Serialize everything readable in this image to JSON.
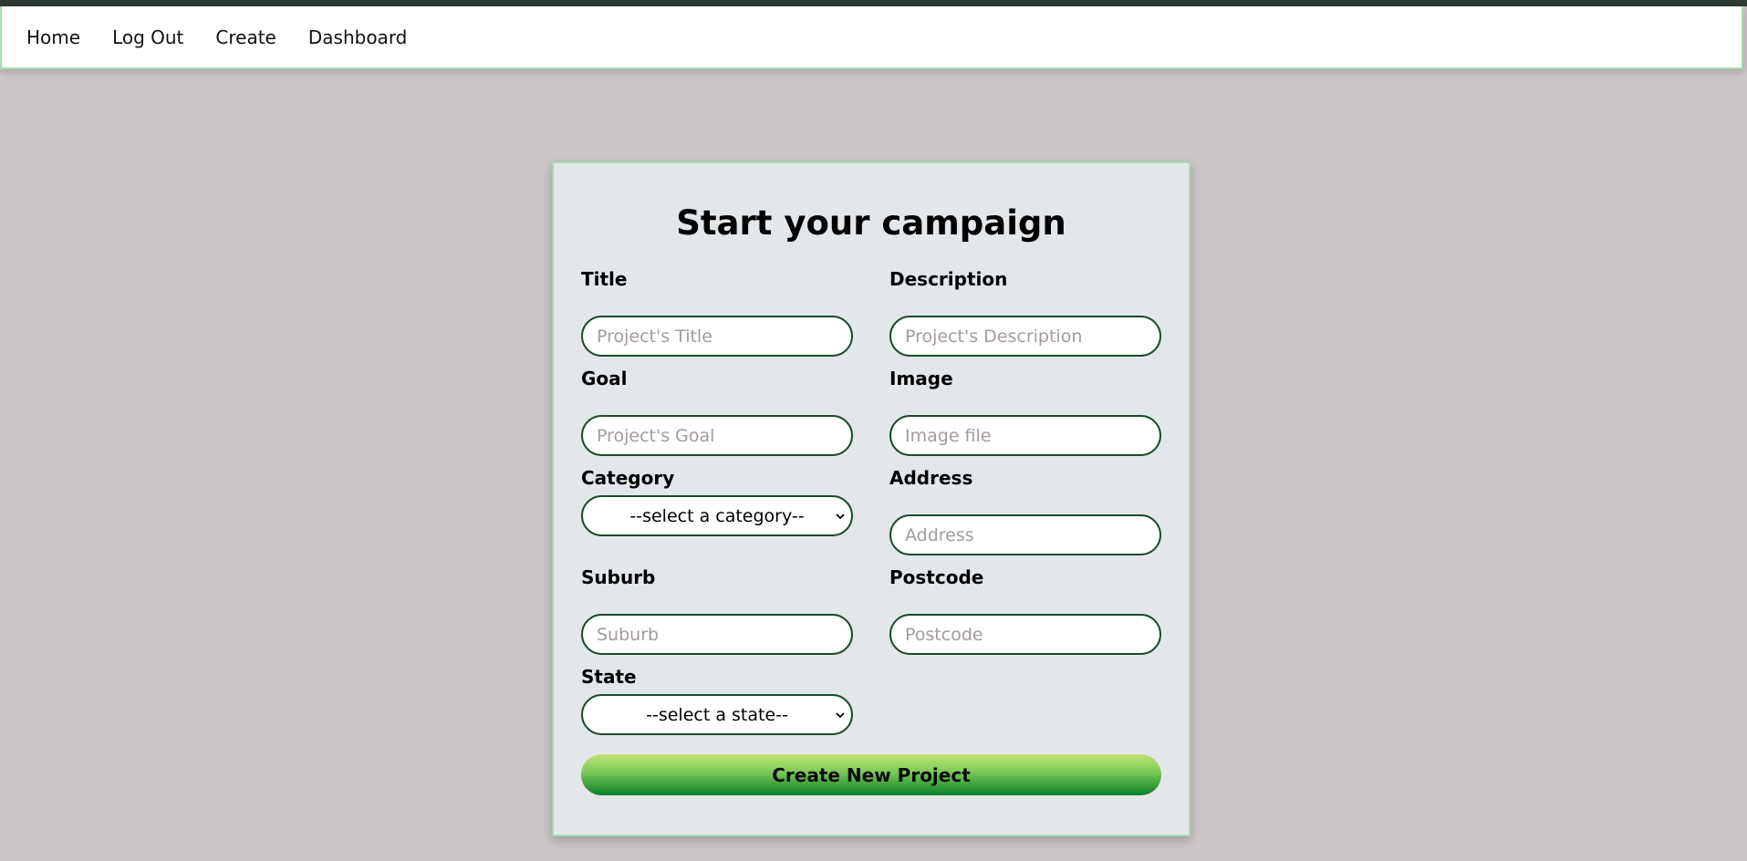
{
  "nav": {
    "links": [
      {
        "label": "Home"
      },
      {
        "label": "Log Out"
      },
      {
        "label": "Create"
      },
      {
        "label": "Dashboard"
      }
    ]
  },
  "form": {
    "title": "Start your campaign",
    "title_field": {
      "label": "Title",
      "placeholder": "Project's Title",
      "value": ""
    },
    "description_field": {
      "label": "Description",
      "placeholder": "Project's Description",
      "value": ""
    },
    "goal_field": {
      "label": "Goal",
      "placeholder": "Project's Goal",
      "value": ""
    },
    "image_field": {
      "label": "Image",
      "placeholder": "Image file",
      "value": ""
    },
    "category_field": {
      "label": "Category",
      "selected": "--select a category--"
    },
    "address_field": {
      "label": "Address",
      "placeholder": "Address",
      "value": ""
    },
    "suburb_field": {
      "label": "Suburb",
      "placeholder": "Suburb",
      "value": ""
    },
    "postcode_field": {
      "label": "Postcode",
      "placeholder": "Postcode",
      "value": ""
    },
    "state_field": {
      "label": "State",
      "selected": "--select a state--"
    },
    "submit_label": "Create New Project"
  },
  "colors": {
    "page_background": "#cbc5c5",
    "card_background": "#e3e7ea",
    "accent_border": "#a9d9b4",
    "input_border": "#1d4a2a",
    "button_gradient_top": "#c4e476",
    "button_gradient_bottom": "#0a7d25"
  }
}
